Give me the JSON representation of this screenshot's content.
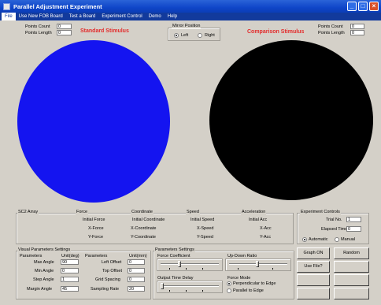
{
  "window": {
    "title": "Parallel Adjustment Experiment",
    "colors": {
      "titlebar": "#0f46c8",
      "menubar": "#123a9c",
      "standard_stimulus": "#1414f0",
      "comparison_stimulus": "#000000",
      "label_red": "#e32c2c"
    }
  },
  "menu": [
    "File",
    "Use New FOB Board",
    "Test a Board",
    "Experiment Control",
    "Demo",
    "Help"
  ],
  "stim_params": {
    "left": {
      "count_label": "Points Count",
      "count_value": "0",
      "length_label": "Points Length",
      "length_value": "0"
    },
    "right": {
      "count_label": "Points Count",
      "count_value": "0",
      "length_label": "Points Length",
      "length_value": "0"
    }
  },
  "stimulus_labels": {
    "standard": "Standard Stimulus",
    "comparison": "Comparison Stimulus"
  },
  "mirror_position": {
    "title": "Mirror Position",
    "options": [
      "Left",
      "Right"
    ],
    "selected": "Left"
  },
  "status_groups": [
    {
      "title": "SC2 Array",
      "rows": []
    },
    {
      "title": "Force",
      "rows": [
        "Initial Force",
        "X-Force",
        "Y-Force"
      ]
    },
    {
      "title": "Coordinate",
      "rows": [
        "Initial Coordinate",
        "X-Coordinate",
        "Y-Coordinate"
      ]
    },
    {
      "title": "Speed",
      "rows": [
        "Initial Speed",
        "X-Speed",
        "Y-Speed"
      ]
    },
    {
      "title": "Acceleration",
      "rows": [
        "Initial Acc",
        "X-Acc",
        "Y-Acc"
      ]
    }
  ],
  "experiment_controls": {
    "title": "Experiment Controls",
    "trial_label": "Trial No.",
    "trial_value": "1",
    "elapsed_label": "Elapsed Time",
    "elapsed_value": "0",
    "mode_options": [
      "Automatic",
      "Manual"
    ],
    "mode_selected": "Automatic"
  },
  "visual_params": {
    "title": "Visual Parameters Settings",
    "col1": {
      "header": "Parameters",
      "unit": "Unit(deg)",
      "rows": [
        {
          "label": "Max Angle",
          "value": "90"
        },
        {
          "label": "Min Angle",
          "value": "0"
        },
        {
          "label": "Step Angle",
          "value": "1"
        },
        {
          "label": "Margin Angle",
          "value": "45"
        }
      ]
    },
    "col2": {
      "header": "Parameters",
      "unit": "Unit(mm)",
      "rows": [
        {
          "label": "Left Offset",
          "value": "0"
        },
        {
          "label": "Top Offset",
          "value": "0"
        },
        {
          "label": "Grid Spacing",
          "value": "0"
        },
        {
          "label": "Sampling Rate",
          "value": "20"
        }
      ]
    }
  },
  "param_settings": {
    "title": "Parameters Settings",
    "force_coeff": "Force Coefficient",
    "updown_ratio": "Up-Down Ratio",
    "output_delay": "Output Time Delay",
    "force_mode_title": "Force Mode",
    "force_mode_options": [
      "Perpendicular to Edge",
      "Parallel to Edge"
    ],
    "force_mode_selected": "Perpendicular to Edge"
  },
  "buttons": [
    {
      "label": "Graph ON",
      "enabled": true
    },
    {
      "label": "Random",
      "enabled": true
    },
    {
      "label": "Use File?",
      "enabled": true
    },
    {
      "label": "",
      "enabled": false
    },
    {
      "label": "",
      "enabled": false
    },
    {
      "label": "",
      "enabled": false
    },
    {
      "label": "",
      "enabled": false
    },
    {
      "label": "",
      "enabled": false
    }
  ]
}
